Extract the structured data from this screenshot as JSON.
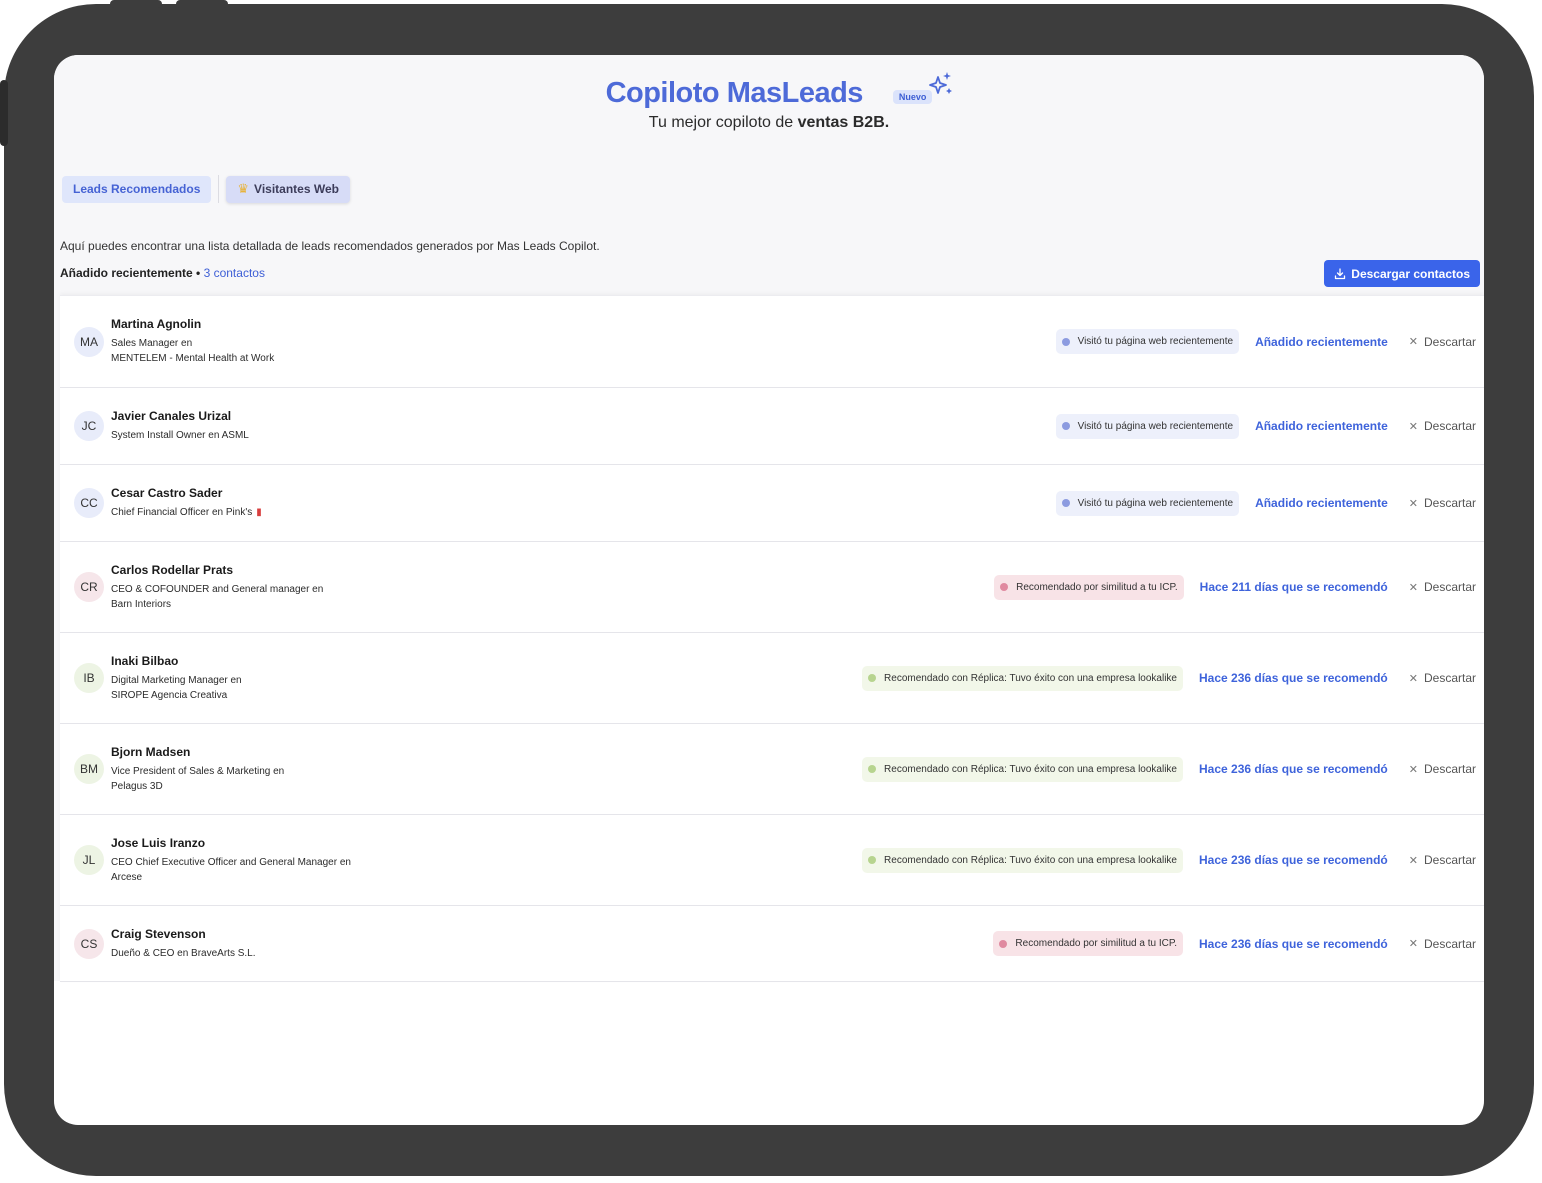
{
  "header": {
    "brand": "Copiloto MasLeads",
    "badge": "Nuevo",
    "tagline_prefix": "Tu mejor copiloto de ",
    "tagline_bold": "ventas B2B."
  },
  "tabs": [
    {
      "label": "Leads Recomendados"
    },
    {
      "label": "Visitantes Web"
    }
  ],
  "intro": "Aquí puedes encontrar una lista detallada de leads recomendados generados por Mas Leads Copilot.",
  "recent": {
    "label": "Añadido recientemente •",
    "count": "3 contactos"
  },
  "download_label": "Descargar contactos",
  "discard_label": "Descartar",
  "leads": [
    {
      "initials": "MA",
      "name": "Martina Agnolin",
      "role1": "Sales Manager en",
      "role2": "MENTELEM - Mental Health at Work",
      "badge": "Visitó tu página web recientemente",
      "status": "Añadido recientemente"
    },
    {
      "initials": "JC",
      "name": "Javier Canales Urizal",
      "role1": "System Install Owner en ASML",
      "role2": "",
      "badge": "Visitó tu página web recientemente",
      "status": "Añadido recientemente"
    },
    {
      "initials": "CC",
      "name": "Cesar Castro Sader",
      "role1": "Chief Financial Officer en Pink's",
      "role2": "",
      "badge": "Visitó tu página web recientemente",
      "status": "Añadido recientemente"
    },
    {
      "initials": "CR",
      "name": "Carlos Rodellar Prats",
      "role1": "CEO & COFOUNDER and General manager en",
      "role2": "Barn Interiors",
      "badge": "Recomendado por similitud a tu ICP.",
      "status": "Hace 211 días que se recomendó"
    },
    {
      "initials": "IB",
      "name": "Inaki Bilbao",
      "role1": "Digital Marketing Manager en",
      "role2": "SIROPE Agencia Creativa",
      "badge": "Recomendado con Réplica: Tuvo éxito con una empresa lookalike",
      "status": "Hace 236 días que se recomendó"
    },
    {
      "initials": "BM",
      "name": "Bjorn Madsen",
      "role1": "Vice President of Sales & Marketing en",
      "role2": "Pelagus 3D",
      "badge": "Recomendado con Réplica: Tuvo éxito con una empresa lookalike",
      "status": "Hace 236 días que se recomendó"
    },
    {
      "initials": "JL",
      "name": "Jose Luis Iranzo",
      "role1": "CEO Chief Executive Officer and General Manager en",
      "role2": "Arcese",
      "badge": "Recomendado con Réplica: Tuvo éxito con una empresa lookalike",
      "status": "Hace 236 días que se recomendó"
    },
    {
      "initials": "CS",
      "name": "Craig Stevenson",
      "role1": "Dueño & CEO en BraveArts S.L.",
      "role2": "",
      "badge": "Recomendado por similitud a tu ICP.",
      "status": "Hace 236 días que se recomendó"
    }
  ],
  "colors": {
    "brand": "#4d6ad8",
    "primary_button": "#3a64ea",
    "link": "#3e63db",
    "device_frame": "#3d3d3d"
  }
}
